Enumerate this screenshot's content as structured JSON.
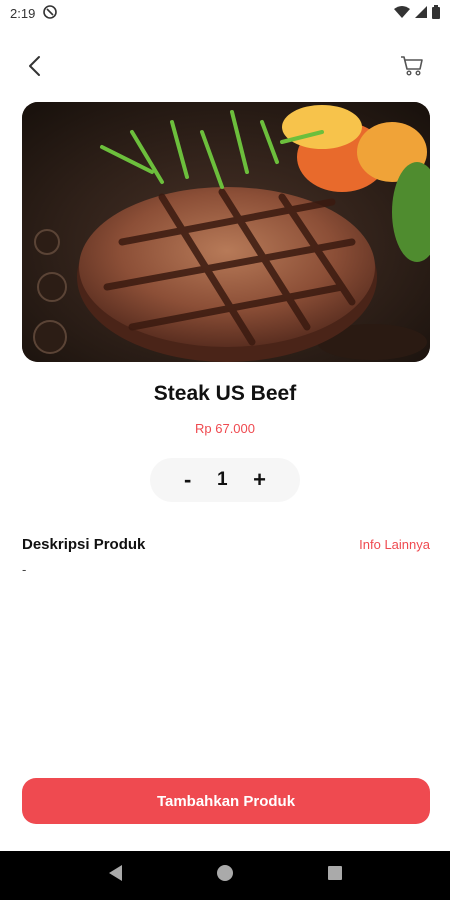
{
  "status_bar": {
    "time": "2:19",
    "icons": [
      "at-sign-icon",
      "wifi-icon",
      "signal-icon",
      "battery-icon"
    ]
  },
  "header": {
    "back_icon": "chevron-left-icon",
    "cart_icon": "cart-icon"
  },
  "product": {
    "name": "Steak US Beef",
    "price": "Rp 67.000",
    "quantity": "1",
    "decrement_label": "-",
    "increment_label": "+"
  },
  "description": {
    "label": "Deskripsi Produk",
    "info_link": "Info Lainnya",
    "value": "-"
  },
  "actions": {
    "add_button": "Tambahkan Produk"
  },
  "colors": {
    "accent": "#ef4a50",
    "background": "#ffffff",
    "navbar": "#000000"
  },
  "nav": {
    "icons": [
      "back-triangle-icon",
      "home-circle-icon",
      "recents-square-icon"
    ]
  }
}
